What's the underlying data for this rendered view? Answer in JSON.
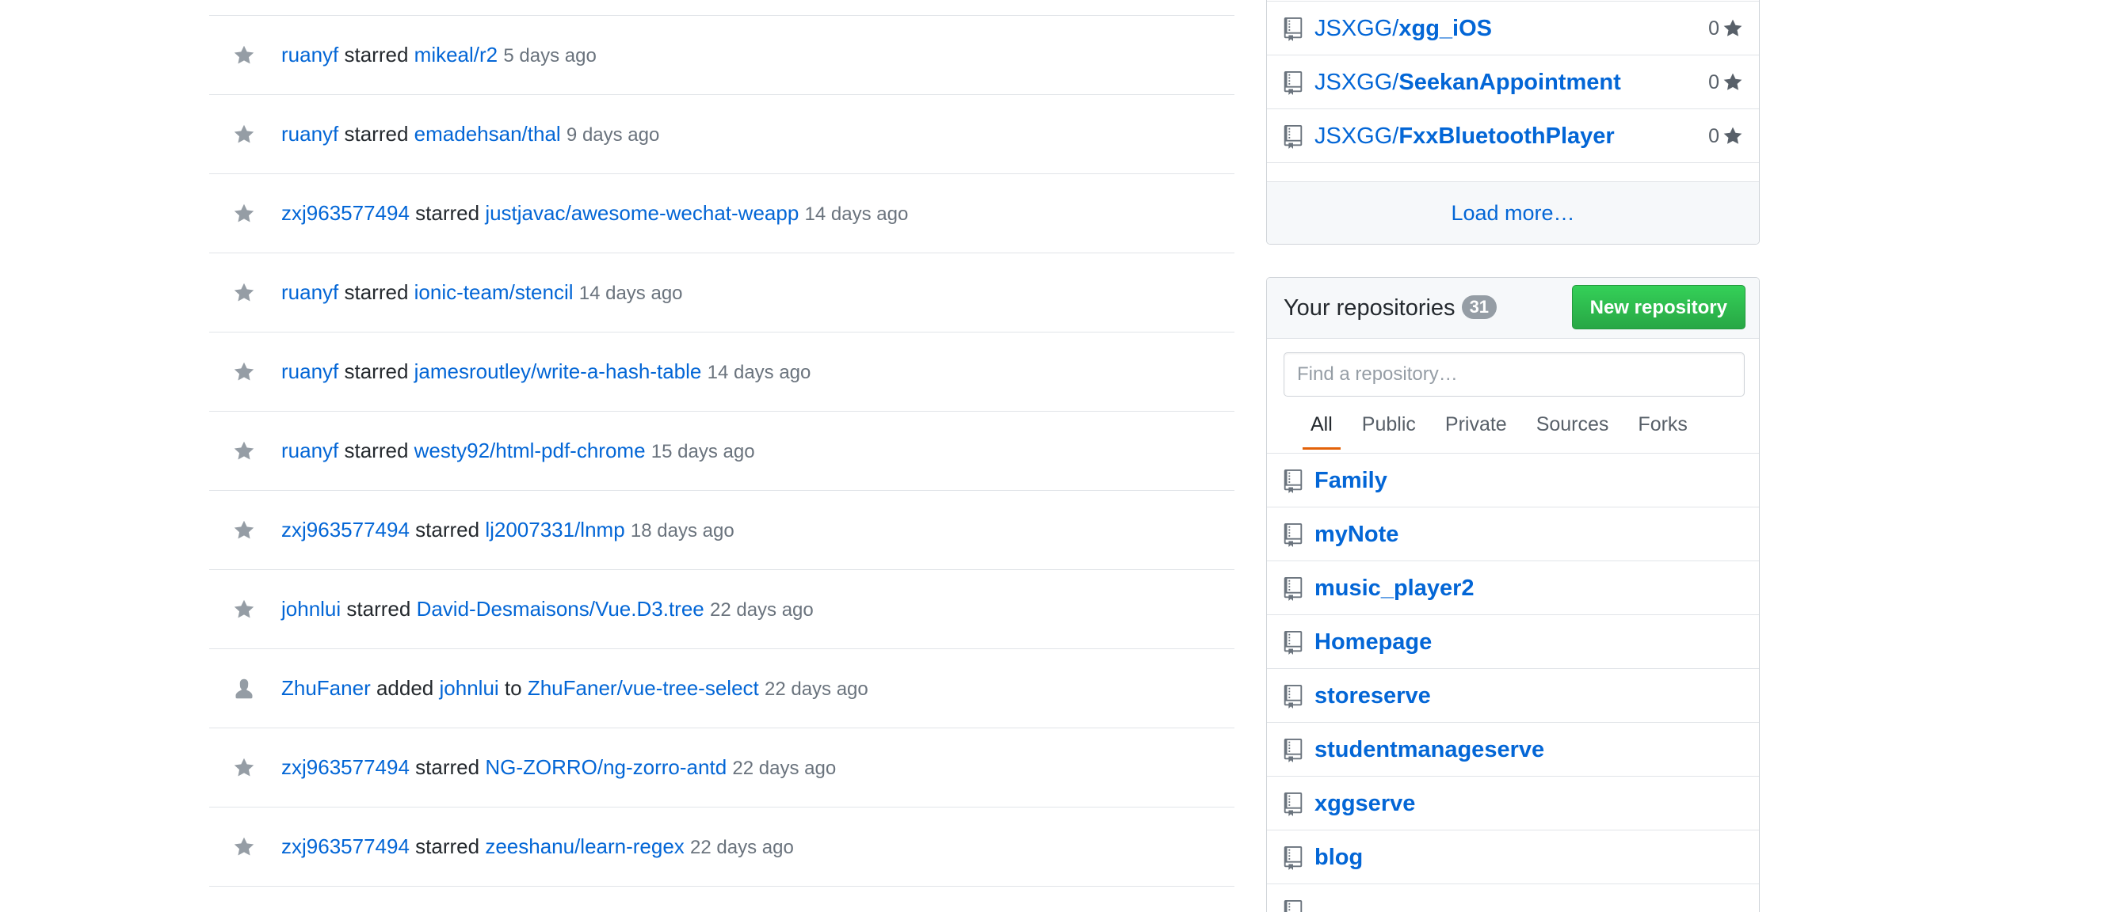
{
  "feed": {
    "items": [
      {
        "icon": "star-icon",
        "actor": "ruanyf",
        "action": "starred",
        "target": "mikeal/r2",
        "time": "5 days ago"
      },
      {
        "icon": "star-icon",
        "actor": "ruanyf",
        "action": "starred",
        "target": "emadehsan/thal",
        "time": "9 days ago"
      },
      {
        "icon": "star-icon",
        "actor": "zxj963577494",
        "action": "starred",
        "target": "justjavac/awesome-wechat-weapp",
        "time": "14 days ago"
      },
      {
        "icon": "star-icon",
        "actor": "ruanyf",
        "action": "starred",
        "target": "ionic-team/stencil",
        "time": "14 days ago"
      },
      {
        "icon": "star-icon",
        "actor": "ruanyf",
        "action": "starred",
        "target": "jamesroutley/write-a-hash-table",
        "time": "14 days ago"
      },
      {
        "icon": "star-icon",
        "actor": "ruanyf",
        "action": "starred",
        "target": "westy92/html-pdf-chrome",
        "time": "15 days ago"
      },
      {
        "icon": "star-icon",
        "actor": "zxj963577494",
        "action": "starred",
        "target": "lj2007331/lnmp",
        "time": "18 days ago"
      },
      {
        "icon": "star-icon",
        "actor": "johnlui",
        "action": "starred",
        "target": "David-Desmaisons/Vue.D3.tree",
        "time": "22 days ago"
      },
      {
        "icon": "person-icon",
        "actor": "ZhuFaner",
        "action": "added",
        "member": "johnlui",
        "connector": "to",
        "target": "ZhuFaner/vue-tree-select",
        "time": "22 days ago"
      },
      {
        "icon": "star-icon",
        "actor": "zxj963577494",
        "action": "starred",
        "target": "NG-ZORRO/ng-zorro-antd",
        "time": "22 days ago"
      },
      {
        "icon": "star-icon",
        "actor": "zxj963577494",
        "action": "starred",
        "target": "zeeshanu/learn-regex",
        "time": "22 days ago"
      }
    ]
  },
  "contributed": {
    "repos": [
      {
        "owner": "JSXGG/",
        "name": "xgg_iOS",
        "stars": "0"
      },
      {
        "owner": "JSXGG/",
        "name": "SeekanAppointment",
        "stars": "0"
      },
      {
        "owner": "JSXGG/",
        "name": "FxxBluetoothPlayer",
        "stars": "0"
      }
    ],
    "load_more": "Load more…"
  },
  "your_repos": {
    "title": "Your repositories",
    "count": "31",
    "new_button": "New repository",
    "search_placeholder": "Find a repository…",
    "tabs": [
      {
        "label": "All",
        "active": true
      },
      {
        "label": "Public",
        "active": false
      },
      {
        "label": "Private",
        "active": false
      },
      {
        "label": "Sources",
        "active": false
      },
      {
        "label": "Forks",
        "active": false
      }
    ],
    "repos": [
      "Family",
      "myNote",
      "music_player2",
      "Homepage",
      "storeserve",
      "studentmanageserve",
      "xggserve",
      "blog"
    ]
  },
  "colors": {
    "link": "#0366d6",
    "muted": "#6a737d",
    "icon": "#959da5",
    "green": "#28a745",
    "tab_underline": "#e36209"
  }
}
